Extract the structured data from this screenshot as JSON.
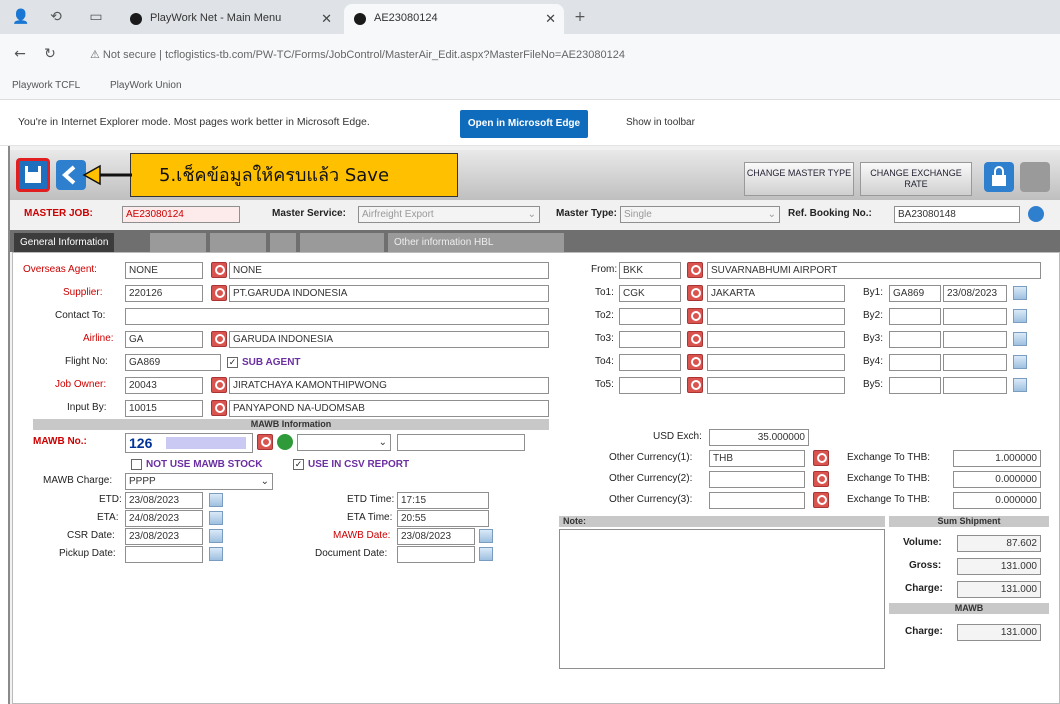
{
  "browser": {
    "tabs": [
      {
        "title": "PlayWork Net - Main Menu"
      },
      {
        "title": "AE23080124"
      }
    ],
    "url": "tcflogistics-tb.com/PW-TC/Forms/JobControl/MasterAir_Edit.aspx?MasterFileNo=AE23080124",
    "not_secure": "Not secure",
    "favorites": [
      "Playwork TCFL",
      "PlayWork Union"
    ],
    "ie_message": "You're in Internet Explorer mode. Most pages work better in Microsoft Edge.",
    "open_edge": "Open in Microsoft Edge",
    "show_toolbar": "Show in toolbar"
  },
  "toolbar": {
    "annotation": "5.เช็คข้อมูลให้ครบแล้ว Save",
    "change_master_type": "CHANGE MASTER TYPE",
    "change_exchange_rate": "CHANGE EXCHANGE RATE"
  },
  "header": {
    "master_job_label": "MASTER JOB:",
    "master_job": "AE23080124",
    "master_service_label": "Master Service:",
    "master_service": "Airfreight Export",
    "master_type_label": "Master Type:",
    "master_type": "Single",
    "ref_booking_label": "Ref. Booking No.:",
    "ref_booking": "BA23080148"
  },
  "tabs": {
    "general": "General Information",
    "other": "Other information HBL"
  },
  "left": {
    "overseas_agent_label": "Overseas Agent:",
    "overseas_agent_code": "NONE",
    "overseas_agent_name": "NONE",
    "supplier_label": "Supplier:",
    "supplier_code": "220126",
    "supplier_name": "PT.GARUDA INDONESIA",
    "contact_label": "Contact To:",
    "airline_label": "Airline:",
    "airline_code": "GA",
    "airline_name": "GARUDA INDONESIA",
    "flight_label": "Flight No:",
    "flight": "GA869",
    "sub_agent": "SUB AGENT",
    "job_owner_label": "Job Owner:",
    "job_owner_code": "20043",
    "job_owner_name": "JIRATCHAYA KAMONTHIPWONG",
    "input_by_label": "Input By:",
    "input_by_code": "10015",
    "input_by_name": "PANYAPOND NA-UDOMSAB",
    "mawb_section": "MAWB Information",
    "mawb_label": "MAWB No.:",
    "mawb": "126",
    "not_use_stock": "NOT USE MAWB STOCK",
    "use_csv": "USE IN CSV REPORT",
    "mawb_charge_label": "MAWB Charge:",
    "mawb_charge": "PPPP",
    "etd_label": "ETD:",
    "etd": "23/08/2023",
    "eta_label": "ETA:",
    "eta": "24/08/2023",
    "csr_label": "CSR Date:",
    "csr": "23/08/2023",
    "pickup_label": "Pickup Date:",
    "etd_time_label": "ETD Time:",
    "etd_time": "17:15",
    "eta_time_label": "ETA Time:",
    "eta_time": "20:55",
    "mawb_date_label": "MAWB Date:",
    "mawb_date": "23/08/2023",
    "doc_date_label": "Document Date:"
  },
  "right": {
    "from_label": "From:",
    "from_code": "BKK",
    "from_name": "SUVARNABHUMI AIRPORT",
    "to1_label": "To1:",
    "to1_code": "CGK",
    "to1_name": "JAKARTA",
    "by1_label": "By1:",
    "by1": "GA869",
    "by1_date": "23/08/2023",
    "to2_label": "To2:",
    "to3_label": "To3:",
    "to4_label": "To4:",
    "to5_label": "To5:",
    "by2_label": "By2:",
    "by3_label": "By3:",
    "by4_label": "By4:",
    "by5_label": "By5:",
    "usd_label": "USD Exch:",
    "usd": "35.000000",
    "oc1_label": "Other Currency(1):",
    "oc1": "THB",
    "oc2_label": "Other Currency(2):",
    "oc3_label": "Other Currency(3):",
    "ex_label": "Exchange To THB:",
    "ex1": "1.000000",
    "ex2": "0.000000",
    "ex3": "0.000000",
    "note_label": "Note:",
    "sum_label": "Sum Shipment",
    "volume_label": "Volume:",
    "volume": "87.602",
    "gross_label": "Gross:",
    "gross": "131.000",
    "charge_label": "Charge:",
    "charge": "131.000",
    "mawb_sum_label": "MAWB",
    "mawb_charge_label": "Charge:",
    "mawb_charge": "131.000"
  },
  "colors": {
    "accent": "#d9534f",
    "save_highlight": "#e02020",
    "annotation": "#ffc000"
  }
}
